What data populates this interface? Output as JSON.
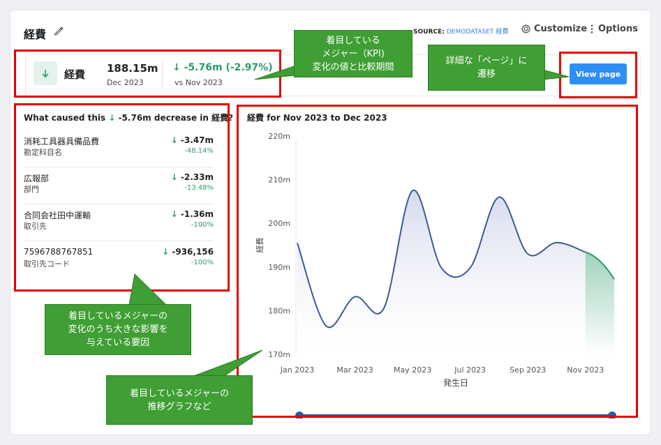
{
  "header": {
    "title": "経費",
    "source_label": "SOURCE:",
    "source_name": "DEMODATASET",
    "source_sub": "経費",
    "customize_label": "Customize",
    "options_label": "Options"
  },
  "kpi": {
    "name": "経費",
    "value": "188.15m",
    "date": "Dec 2023",
    "delta": "-5.76m (-2.97%)",
    "compare": "vs Nov 2023",
    "view_button": "View page"
  },
  "causes": {
    "title_prefix": "What caused this",
    "title_rest": "-5.76m decrease in 経費?",
    "items": [
      {
        "name": "消耗工具器具備品費",
        "dimension": "勘定科目名",
        "value": "-3.47m",
        "percent": "-48.14%"
      },
      {
        "name": "広報部",
        "dimension": "部門",
        "value": "-2.33m",
        "percent": "-13.48%"
      },
      {
        "name": "合同会社田中運輸",
        "dimension": "取引先",
        "value": "-1.36m",
        "percent": "-100%"
      },
      {
        "name": "7596788767851",
        "dimension": "取引先コード",
        "value": "-936,156",
        "percent": "-100%"
      }
    ]
  },
  "annotations": {
    "kpi_note": [
      "着目している",
      "メジャー（KPI)",
      "変化の値と比較期間"
    ],
    "view_note": [
      "詳細な「ページ」に",
      "遷移"
    ],
    "causes_note": [
      "着目しているメジャーの",
      "変化のうち大きな影響を",
      "与えている要因"
    ],
    "chart_note": [
      "着目しているメジャーの",
      "推移グラフなど"
    ]
  },
  "chart_data": {
    "type": "area",
    "title": "経費 for Nov 2023 to Dec 2023",
    "xlabel": "発生日",
    "ylabel": "経費",
    "y_ticks": [
      "170m",
      "180m",
      "190m",
      "200m",
      "210m",
      "220m"
    ],
    "ylim": [
      170,
      220
    ],
    "x_tick_labels": [
      "Jan 2023",
      "Mar 2023",
      "May 2023",
      "Jul 2023",
      "Sep 2023",
      "Nov 2023"
    ],
    "x": [
      "Jan 2023",
      "Feb 2023",
      "Mar 2023",
      "Apr 2023",
      "May 2023",
      "Jun 2023",
      "Jul 2023",
      "Aug 2023",
      "Sep 2023",
      "Oct 2023",
      "Nov 2023",
      "Dec 2023"
    ],
    "series": [
      {
        "values": [
          195.5,
          176.5,
          183.2,
          180.5,
          207.5,
          189.8,
          189.8,
          206,
          193,
          195.6,
          193.4,
          187.2
        ]
      }
    ],
    "line_color": "#3d5a93",
    "highlight_color": "#2e9b6a",
    "grid": false
  }
}
